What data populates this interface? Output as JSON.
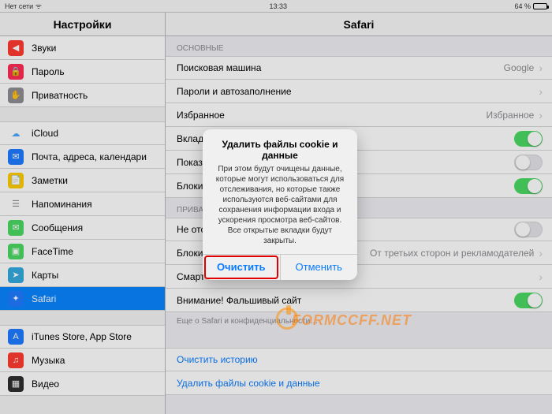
{
  "status": {
    "network": "Нет сети",
    "time": "13:33",
    "battery": "64 %"
  },
  "sidebar_title": "Настройки",
  "detail_title": "Safari",
  "sidebar": [
    {
      "label": "Звуки",
      "icon_bg": "#ff3b30",
      "glyph": "◀"
    },
    {
      "label": "Пароль",
      "icon_bg": "#ff2d55",
      "glyph": "🔒"
    },
    {
      "label": "Приватность",
      "icon_bg": "#8e8e93",
      "glyph": "✋"
    },
    {
      "label": "iCloud",
      "icon_bg": "#ffffff",
      "glyph": "☁",
      "gap": true,
      "fg": "#4aa8ff"
    },
    {
      "label": "Почта, адреса, календари",
      "icon_bg": "#1f7cff",
      "glyph": "✉"
    },
    {
      "label": "Заметки",
      "icon_bg": "#ffcc00",
      "glyph": "📄",
      "fg": "#8a6d00"
    },
    {
      "label": "Напоминания",
      "icon_bg": "#ffffff",
      "glyph": "☰",
      "fg": "#8e8e93"
    },
    {
      "label": "Сообщения",
      "icon_bg": "#4cd964",
      "glyph": "✉"
    },
    {
      "label": "FaceTime",
      "icon_bg": "#4cd964",
      "glyph": "▣"
    },
    {
      "label": "Карты",
      "icon_bg": "#34aadc",
      "glyph": "➤"
    },
    {
      "label": "Safari",
      "icon_bg": "#1f7cff",
      "glyph": "✦",
      "selected": true
    },
    {
      "label": "iTunes Store, App Store",
      "icon_bg": "#1f7cff",
      "glyph": "A",
      "gap": true
    },
    {
      "label": "Музыка",
      "icon_bg": "#ff3b30",
      "glyph": "♫"
    },
    {
      "label": "Видео",
      "icon_bg": "#2e2e2e",
      "glyph": "▦"
    }
  ],
  "sections": {
    "main_header": "ОСНОВНЫЕ",
    "rows1": [
      {
        "label": "Поисковая машина",
        "value": "Google",
        "chev": true
      },
      {
        "label": "Пароли и автозаполнение",
        "chev": true
      },
      {
        "label": "Избранное",
        "value": "Избранное",
        "chev": true
      },
      {
        "label": "Вкладки",
        "toggle": "on"
      },
      {
        "label": "Показать панель вкладок",
        "toggle": "off"
      },
      {
        "label": "Блокировать всплывающие окна",
        "toggle": "on"
      }
    ],
    "priv_header": "ПРИВАТНОСТЬ",
    "rows2": [
      {
        "label": "Не отслеживать",
        "toggle": "off"
      },
      {
        "label": "Блокировать cookie",
        "value": "От третьих сторон и рекламодателей",
        "chev": true
      },
      {
        "label": "Смарт-поле поиска",
        "chev": true
      },
      {
        "label": "Внимание! Фальшивый сайт",
        "toggle": "on"
      }
    ],
    "footer_note": "Еще о Safari и конфиденциальности…",
    "rows3": [
      {
        "label": "Очистить историю"
      },
      {
        "label": "Удалить файлы cookie и данные"
      }
    ]
  },
  "alert": {
    "title": "Удалить файлы cookie и данные",
    "message": "При этом будут очищены данные, которые могут использоваться для отслеживания, но которые также используются веб-сайтами для сохранения информации входа и ускорения просмотра веб-сайтов. Все открытые вкладки будут закрыты.",
    "confirm": "Очистить",
    "cancel": "Отменить"
  },
  "watermark": "FORMCCFF.NET"
}
